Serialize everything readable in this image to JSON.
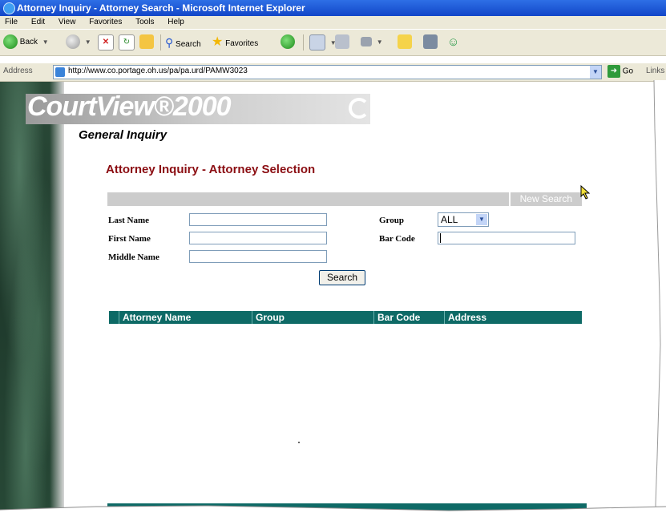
{
  "window": {
    "title": "Attorney Inquiry - Attorney Search - Microsoft Internet Explorer"
  },
  "menu": [
    "File",
    "Edit",
    "View",
    "Favorites",
    "Tools",
    "Help"
  ],
  "toolbar": {
    "back_label": "Back",
    "search_label": "Search",
    "favorites_label": "Favorites"
  },
  "address": {
    "label": "Address",
    "url": "http://www.co.portage.oh.us/pa/pa.urd/PAMW3023",
    "go_label": "Go",
    "links_label": "Links"
  },
  "page": {
    "logo": "CourtView®2000",
    "section": "General Inquiry",
    "heading": "Attorney Inquiry - Attorney Selection",
    "new_search": "New Search"
  },
  "form": {
    "last_name_label": "Last Name",
    "first_name_label": "First Name",
    "middle_name_label": "Middle Name",
    "group_label": "Group",
    "group_value": "ALL",
    "bar_code_label": "Bar Code",
    "last_name_value": "",
    "first_name_value": "",
    "middle_name_value": "",
    "bar_code_value": "",
    "search_button": "Search"
  },
  "results": {
    "columns": [
      "Attorney Name",
      "Group",
      "Bar Code",
      "Address"
    ]
  },
  "colors": {
    "heading": "#8b0d12",
    "table_header": "#0e6a66",
    "grey_bar": "#cccccc"
  }
}
